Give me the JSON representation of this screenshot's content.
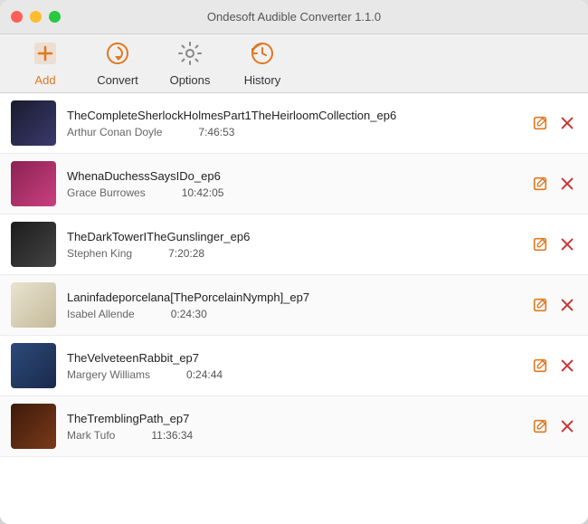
{
  "window": {
    "title": "Ondesoft Audible Converter 1.1.0"
  },
  "toolbar": {
    "add_label": "Add",
    "convert_label": "Convert",
    "options_label": "Options",
    "history_label": "History"
  },
  "books": [
    {
      "id": 1,
      "title": "TheCompleteSherlockHolmesPart1TheHeirloomCollection_ep6",
      "author": "Arthur Conan Doyle",
      "duration": "7:46:53",
      "thumb_class": "book-thumb-1"
    },
    {
      "id": 2,
      "title": "WhenaDuchessSaysIDo_ep6",
      "author": "Grace Burrowes",
      "duration": "10:42:05",
      "thumb_class": "book-thumb-2"
    },
    {
      "id": 3,
      "title": "TheDarkTowerITheGunslinger_ep6",
      "author": "Stephen King",
      "duration": "7:20:28",
      "thumb_class": "book-thumb-3"
    },
    {
      "id": 4,
      "title": "Laninfadeporcelana[ThePorcelainNymph]_ep7",
      "author": "Isabel Allende",
      "duration": "0:24:30",
      "thumb_class": "book-thumb-4"
    },
    {
      "id": 5,
      "title": "TheVelveteenRabbit_ep7",
      "author": "Margery Williams",
      "duration": "0:24:44",
      "thumb_class": "book-thumb-5"
    },
    {
      "id": 6,
      "title": "TheTremblingPath_ep7",
      "author": "Mark Tufo",
      "duration": "11:36:34",
      "thumb_class": "book-thumb-6"
    }
  ]
}
